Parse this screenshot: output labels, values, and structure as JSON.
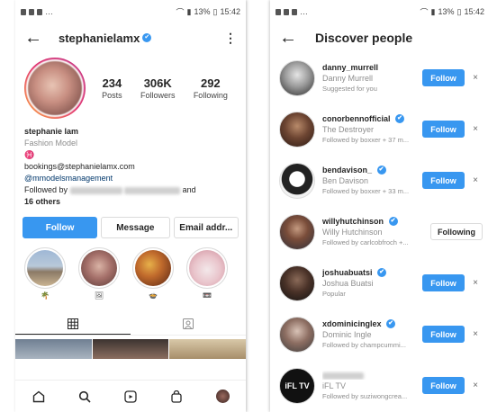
{
  "left": {
    "status": {
      "time": "15:42",
      "battery": "13%"
    },
    "header": {
      "username": "stephanielamx",
      "verified": "✔"
    },
    "stats": [
      {
        "num": "234",
        "label": "Posts"
      },
      {
        "num": "306K",
        "label": "Followers"
      },
      {
        "num": "292",
        "label": "Following"
      }
    ],
    "bio": {
      "name": "stephanie lam",
      "category": "Fashion Model",
      "symbol": "♓",
      "email": "bookings@stephanielamx.com",
      "mention": "@mmodelsmanagement",
      "followed_prefix": "Followed by",
      "and_text": "and",
      "others": "16 others"
    },
    "buttons": {
      "follow": "Follow",
      "message": "Message",
      "email": "Email addr..."
    },
    "highlight_emojis": [
      "🌴",
      "🖼",
      "🍲",
      "📼"
    ]
  },
  "right": {
    "status": {
      "time": "15:42",
      "battery": "13%"
    },
    "title": "Discover people",
    "close_glyph": "×",
    "people": [
      {
        "username": "danny_murrell",
        "verified": false,
        "name": "Danny Murrell",
        "sub": "Suggested for you",
        "button": "Follow"
      },
      {
        "username": "conorbennofficial",
        "verified": true,
        "name": "The Destroyer",
        "sub": "Followed by boxxer + 37 m...",
        "button": "Follow"
      },
      {
        "username": "bendavison_",
        "verified": true,
        "name": "Ben Davison",
        "sub": "Followed by boxxer + 33 m...",
        "button": "Follow"
      },
      {
        "username": "willyhutchinson",
        "verified": true,
        "name": "Willy Hutchinson",
        "sub": "Followed by carlcobfroch +...",
        "button": "Following"
      },
      {
        "username": "joshuabuatsi",
        "verified": true,
        "name": "Joshua Buatsi",
        "sub": "Popular",
        "button": "Follow"
      },
      {
        "username": "xdominicinglex",
        "verified": true,
        "name": "Dominic Ingle",
        "sub": "Followed by champcummi...",
        "button": "Follow"
      },
      {
        "username": "",
        "verified": false,
        "name": "iFL TV",
        "sub": "Followed by suziwongcrea...",
        "button": "Follow"
      }
    ]
  }
}
